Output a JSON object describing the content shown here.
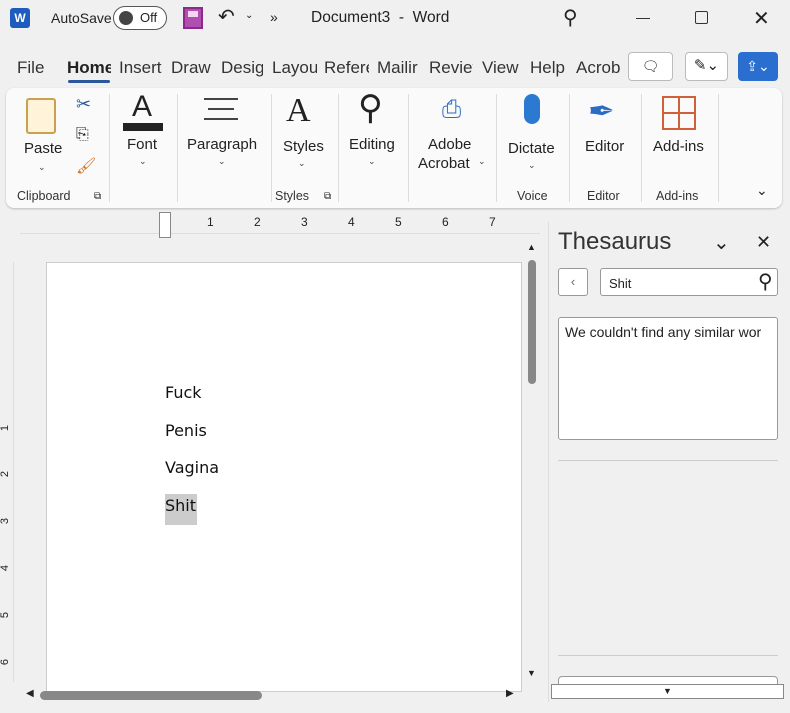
{
  "titlebar": {
    "autosave_label": "AutoSave",
    "autosave_state": "Off",
    "more": "»",
    "title": "Document3  -  Word"
  },
  "tabs": [
    "File",
    "Home",
    "Insert",
    "Draw",
    "Desig",
    "Layou",
    "Refere",
    "Mailir",
    "Reviev",
    "View",
    "Help",
    "Acrob"
  ],
  "active_tab": "Home",
  "ribbon": {
    "paste": "Paste",
    "font": "Font",
    "paragraph": "Paragraph",
    "styles": "Styles",
    "editing": "Editing",
    "adobe1": "Adobe",
    "adobe2": "Acrobat",
    "dictate": "Dictate",
    "editor": "Editor",
    "addins": "Add-ins",
    "groups": {
      "clipboard": "Clipboard",
      "styles": "Styles",
      "voice": "Voice",
      "editor": "Editor",
      "addins": "Add-ins"
    }
  },
  "ruler": {
    "numbers": [
      "1",
      "2",
      "3",
      "4",
      "5",
      "6",
      "7"
    ],
    "vnumbers": [
      "1",
      "2",
      "3",
      "4",
      "5",
      "6"
    ]
  },
  "document": {
    "lines": [
      "Fuck",
      "Penis",
      "Vagina",
      "Shit"
    ]
  },
  "thesaurus": {
    "title": "Thesaurus",
    "search_value": "Shit",
    "message": "We couldn't find any similar wor"
  },
  "colors": {
    "accent": "#2b579a",
    "share": "#2a6fcf",
    "selection": "#cccccc"
  }
}
